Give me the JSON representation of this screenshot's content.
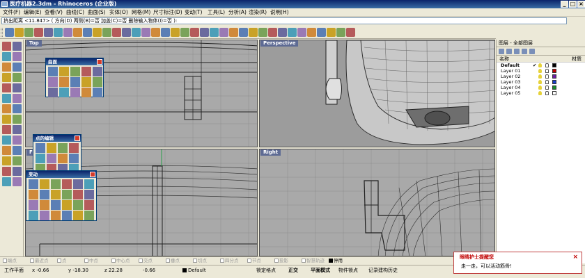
{
  "window": {
    "title": "医疗机器2.3dm - Rhinoceros (企业版)",
    "minimize": "_",
    "maximize": "□",
    "close": "×"
  },
  "menu": [
    "文件(F)",
    "编辑(E)",
    "查看(V)",
    "曲线(C)",
    "曲面(S)",
    "实体(O)",
    "网格(M)",
    "尺寸标注(D)",
    "变动(T)",
    "工具(L)",
    "分析(A)",
    "渲染(R)",
    "说明(H)"
  ],
  "command": {
    "prompt": "挤出距离 <11.847> ( 方向(D)  两侧(B)=否  加盖(C)=否  删除输入物体(I)=否 ):"
  },
  "toolbar": {
    "icons": [
      "new-icon",
      "open-icon",
      "save-icon",
      "print-icon",
      "cut-icon",
      "copy-icon",
      "paste-icon",
      "undo-icon",
      "redo-icon",
      "pan-icon",
      "rotate-view-icon",
      "zoom-icon",
      "zoom-window-icon",
      "zoom-extents-icon",
      "zoom-selected-icon",
      "undo-view-icon",
      "grid-icon",
      "four-viewports-icon",
      "ortho-icon",
      "wireframe-icon",
      "shade-icon",
      "render-icon",
      "properties-icon",
      "layer-icon",
      "light-icon",
      "snap-icon",
      "settings-icon",
      "material-icon",
      "color-icon",
      "sphere-icon",
      "globe-icon",
      "point-icon",
      "options-icon",
      "help-icon",
      "grid-toggle-icon",
      "panel-icon"
    ]
  },
  "viewports": {
    "top": "Top",
    "perspective": "Perspective",
    "front": "Front",
    "right": "Right"
  },
  "palettes": {
    "surface": "曲面",
    "point_edit": "点的编辑",
    "transform": "变动"
  },
  "layer_panel": {
    "title": "图层 - 全部图层",
    "col_name": "名称",
    "col_material": "材质",
    "current_mark": "✔",
    "layers": [
      {
        "name": "Default",
        "color": "#000000",
        "current": true
      },
      {
        "name": "Layer 01",
        "color": "#c00000",
        "current": false
      },
      {
        "name": "Layer 02",
        "color": "#6a1fa0",
        "current": false
      },
      {
        "name": "Layer 03",
        "color": "#1a3ec8",
        "current": false
      },
      {
        "name": "Layer 04",
        "color": "#1a8a2a",
        "current": false
      },
      {
        "name": "Layer 05",
        "color": "#ffffff",
        "current": false
      }
    ]
  },
  "osnap": [
    {
      "label": "端点",
      "on": false
    },
    {
      "label": "最近点",
      "on": false
    },
    {
      "label": "点",
      "on": false
    },
    {
      "label": "中点",
      "on": false
    },
    {
      "label": "中心点",
      "on": false
    },
    {
      "label": "交点",
      "on": false
    },
    {
      "label": "垂点",
      "on": false
    },
    {
      "label": "切点",
      "on": false
    },
    {
      "label": "四分点",
      "on": false
    },
    {
      "label": "节点",
      "on": false
    },
    {
      "label": "投影",
      "on": false
    },
    {
      "label": "智慧轨迹",
      "on": false
    },
    {
      "label": "停用",
      "on": true
    }
  ],
  "status": {
    "cplane": "工作平面",
    "x": "x -0.66",
    "y": "y -18.30",
    "z": "z 22.28",
    "delta": "-0.66",
    "layer": "Default",
    "lock_osnap": "锁定格点",
    "ortho": "正交",
    "planar": "平面模式",
    "object_snap": "物件锁点",
    "history": "记录建构历史"
  },
  "notification": {
    "title": "眼睛护士提醒您",
    "message": "走一走，可以活动筋骨!",
    "close": "×"
  }
}
